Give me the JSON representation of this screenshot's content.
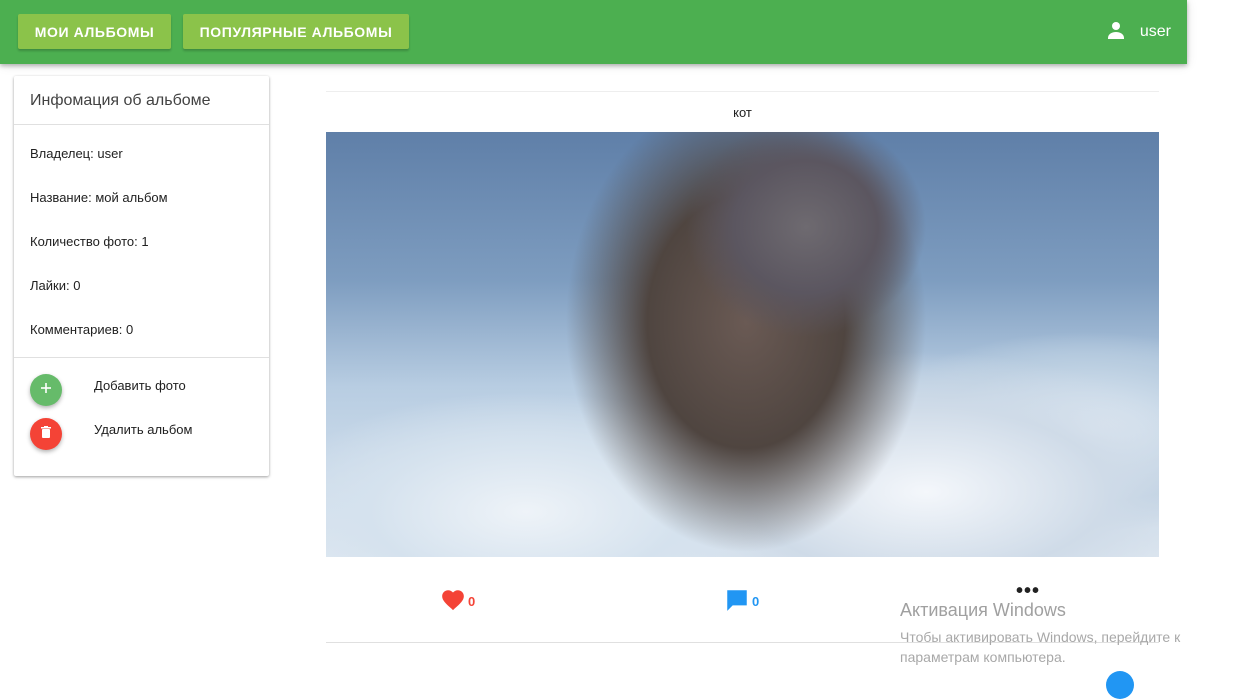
{
  "appbar": {
    "my_albums": "МОИ АЛЬБОМЫ",
    "popular_albums": "ПОПУЛЯРНЫЕ АЛЬБОМЫ",
    "username": "user",
    "user_icon": "account-icon",
    "color": "#4caf50",
    "button_color": "#8bc34a"
  },
  "album_info": {
    "title": "Инфомация об альбоме",
    "owner": "Владелец: user",
    "name": "Название: мой альбом",
    "photo_count": "Количество фото: 1",
    "likes": "Лайки: 0",
    "comments": "Комментариев: 0",
    "add_photo_label": "Добавить фото",
    "add_icon": "plus-icon",
    "delete_album_label": "Удалить альбом",
    "delete_icon": "trash-icon"
  },
  "photo": {
    "title": "кот",
    "likes_count": "0",
    "comments_count": "0",
    "like_icon": "heart-icon",
    "comment_icon": "comment-icon",
    "more_label": "•••"
  },
  "watermark": {
    "line1": "Активация Windows",
    "line2": "Чтобы активировать Windows, перейдите к",
    "line3": "параметрам компьютера."
  }
}
